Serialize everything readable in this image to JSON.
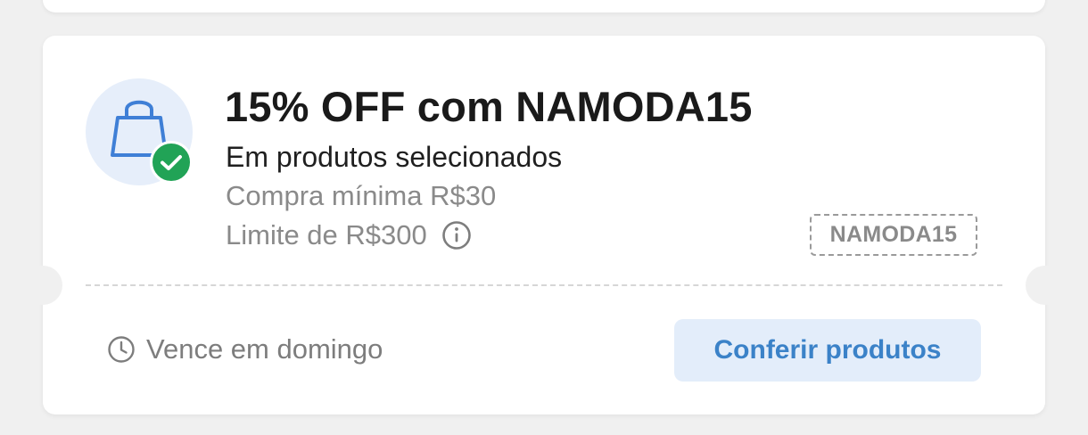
{
  "coupon": {
    "title": "15% OFF com NAMODA15",
    "subtitle": "Em produtos selecionados",
    "min_purchase": "Compra mínima R$30",
    "limit": "Limite de R$300",
    "code": "NAMODA15",
    "expires": "Vence em domingo",
    "cta_label": "Conferir produtos",
    "icons": {
      "main": "shopping-bag-icon",
      "badge": "check-icon",
      "info": "info-icon",
      "expires": "clock-icon"
    },
    "colors": {
      "accent": "#3b82c8",
      "icon_bg": "#e6eefa",
      "bag_stroke": "#3f7fd6",
      "check_badge": "#21a356",
      "cta_bg": "#e3edfa",
      "title_text": "#1a1a1a",
      "muted_text": "#8a8a8a",
      "page_bg": "#f0f0f0"
    }
  }
}
